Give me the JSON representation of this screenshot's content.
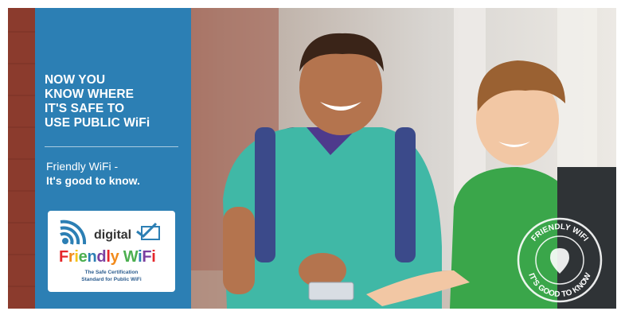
{
  "headline": [
    "NOW YOU",
    "KNOW WHERE",
    "IT'S SAFE TO",
    "USE PUBLIC WiFi"
  ],
  "tagline": {
    "line1": "Friendly WiFi -",
    "line2": "It's good to know."
  },
  "logo": {
    "word1": "digital",
    "name": [
      "F",
      "r",
      "i",
      "e",
      "n",
      "d",
      "l",
      "y",
      " ",
      "W",
      "i",
      "F",
      "i"
    ],
    "sub1": "The Safe Certification",
    "sub2": "Standard for Public WiFi"
  },
  "badge": {
    "top": "FRIENDLY WIFI",
    "bottom": "IT'S GOOD TO KNOW"
  },
  "colors": {
    "panel": "#2c7fb4",
    "logo_letters": [
      "#e5262b",
      "#f28b1c",
      "#f7c419",
      "#4caf50",
      "#2c7fb4",
      "#7b3fa0",
      "#e5262b",
      "#f28b1c",
      "#333333",
      "#4caf50",
      "#2c7fb4",
      "#7b3fa0",
      "#e5262b"
    ]
  }
}
